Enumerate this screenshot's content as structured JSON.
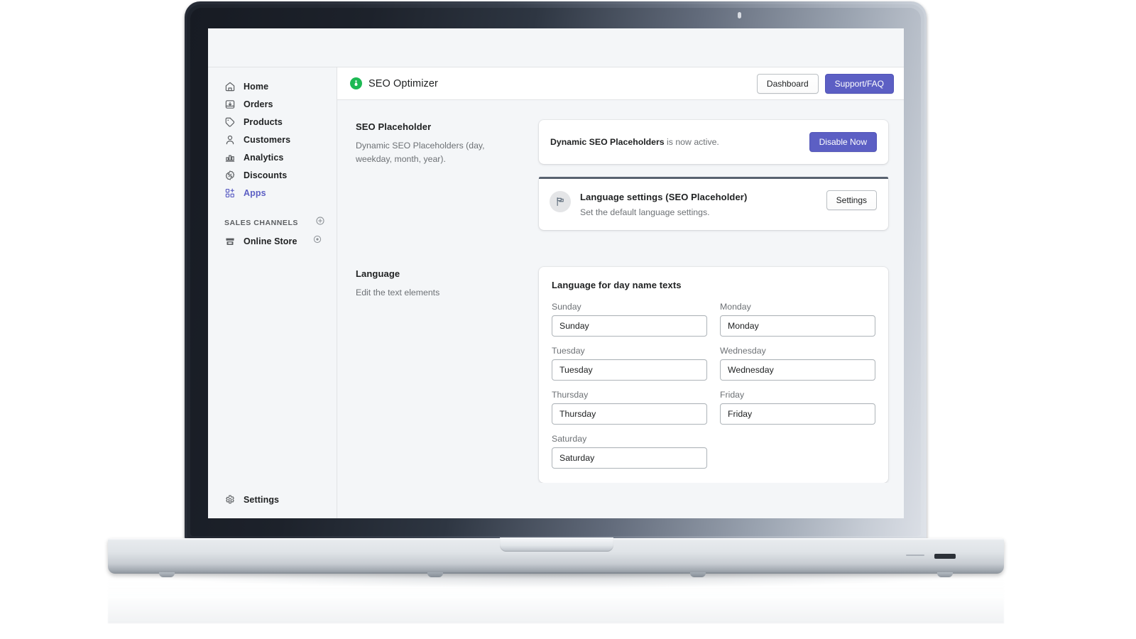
{
  "app": {
    "title": "SEO Optimizer",
    "brand_icon": "seo-optimizer-logo-icon",
    "accent_color": "#5c5fc4",
    "logo_color": "#1db954",
    "header_buttons": [
      {
        "label": "Dashboard",
        "style": "default",
        "name": "dashboard-button"
      },
      {
        "label": "Support/FAQ",
        "style": "primary",
        "name": "support-faq-button"
      }
    ]
  },
  "sidebar": {
    "items": [
      {
        "label": "Home",
        "icon": "home-icon",
        "active": false
      },
      {
        "label": "Orders",
        "icon": "orders-icon",
        "active": false
      },
      {
        "label": "Products",
        "icon": "products-tag-icon",
        "active": false
      },
      {
        "label": "Customers",
        "icon": "customers-person-icon",
        "active": false
      },
      {
        "label": "Analytics",
        "icon": "analytics-bar-chart-icon",
        "active": false
      },
      {
        "label": "Discounts",
        "icon": "discounts-percent-icon",
        "active": false
      },
      {
        "label": "Apps",
        "icon": "apps-grid-plus-icon",
        "active": true
      }
    ],
    "sales_channels": {
      "title": "SALES CHANNELS",
      "add_icon": "plus-circle-icon",
      "items": [
        {
          "label": "Online Store",
          "icon": "online-store-icon",
          "trailing_icon": "eye-icon"
        }
      ]
    },
    "settings": {
      "label": "Settings",
      "icon": "gear-icon"
    }
  },
  "seo_section": {
    "heading": "SEO Placeholder",
    "description": "Dynamic SEO Placeholders (day, weekday, month, year).",
    "banner": {
      "strong_text": "Dynamic SEO Placeholders",
      "rest_text": " is now active.",
      "button_label": "Disable Now"
    },
    "settings_card": {
      "icon": "flag-icon",
      "title": "Language settings (SEO Placeholder)",
      "subtitle": "Set the default language settings.",
      "button_label": "Settings"
    }
  },
  "language_section": {
    "aside_heading": "Language",
    "aside_description": "Edit the text elements",
    "card_title": "Language for day name texts",
    "fields": [
      {
        "label": "Sunday",
        "value": "Sunday",
        "name": "sunday-input"
      },
      {
        "label": "Monday",
        "value": "Monday",
        "name": "monday-input"
      },
      {
        "label": "Tuesday",
        "value": "Tuesday",
        "name": "tuesday-input"
      },
      {
        "label": "Wednesday",
        "value": "Wednesday",
        "name": "wednesday-input"
      },
      {
        "label": "Thursday",
        "value": "Thursday",
        "name": "thursday-input"
      },
      {
        "label": "Friday",
        "value": "Friday",
        "name": "friday-input"
      },
      {
        "label": "Saturday",
        "value": "Saturday",
        "name": "saturday-input"
      }
    ]
  }
}
